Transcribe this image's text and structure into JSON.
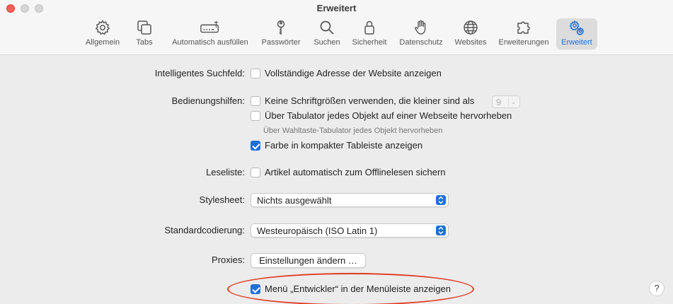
{
  "window": {
    "title": "Erweitert"
  },
  "toolbar": {
    "items": [
      {
        "label": "Allgemein",
        "icon": "gear-icon"
      },
      {
        "label": "Tabs",
        "icon": "tabs-icon"
      },
      {
        "label": "Automatisch ausfüllen",
        "icon": "autofill-icon"
      },
      {
        "label": "Passwörter",
        "icon": "key-icon"
      },
      {
        "label": "Suchen",
        "icon": "search-icon"
      },
      {
        "label": "Sicherheit",
        "icon": "lock-icon"
      },
      {
        "label": "Datenschutz",
        "icon": "hand-icon"
      },
      {
        "label": "Websites",
        "icon": "globe-icon"
      },
      {
        "label": "Erweiterungen",
        "icon": "puzzle-icon"
      },
      {
        "label": "Erweitert",
        "icon": "gears-icon"
      }
    ],
    "active": "Erweitert",
    "accent_color": "#1f6fd6"
  },
  "settings": {
    "smart_search": {
      "label": "Intelligentes Suchfeld:",
      "option": "Vollständige Adresse der Website anzeigen",
      "checked": false
    },
    "accessibility": {
      "label": "Bedienungshilfen:",
      "font_size_option": "Keine Schriftgrößen verwenden, die kleiner sind als",
      "font_size_checked": false,
      "font_size_value": "9",
      "tab_option": "Über Tabulator jedes Objekt auf einer Webseite hervorheben",
      "tab_checked": false,
      "tab_hint": "Über Wahltaste-Tabulator jedes Objekt hervorheben",
      "color_option": "Farbe in kompakter Tableiste anzeigen",
      "color_checked": true
    },
    "reading_list": {
      "label": "Leseliste:",
      "option": "Artikel automatisch zum Offlinelesen sichern",
      "checked": false
    },
    "stylesheet": {
      "label": "Stylesheet:",
      "value": "Nichts ausgewählt"
    },
    "encoding": {
      "label": "Standardcodierung:",
      "value": "Westeuropäisch (ISO Latin 1)"
    },
    "proxies": {
      "label": "Proxies:",
      "button": "Einstellungen ändern …"
    },
    "developer_menu": {
      "option": "Menü „Entwickler“ in der Menüleiste anzeigen",
      "checked": true,
      "highlight_color": "#e03a22"
    }
  },
  "help": {
    "label": "?"
  }
}
